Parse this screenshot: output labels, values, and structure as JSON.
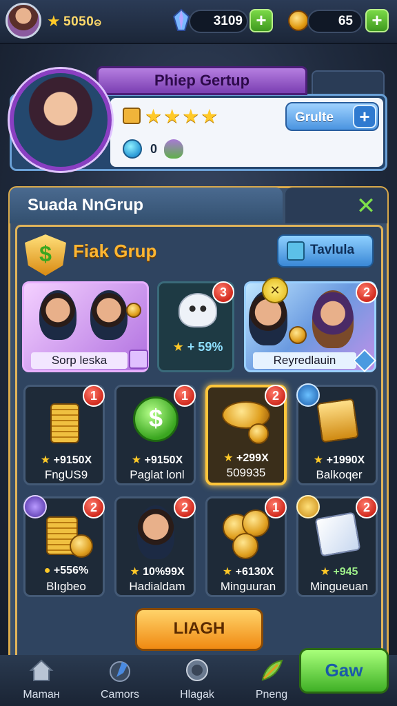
{
  "topbar": {
    "score": "5050ဓ",
    "gems": "3109",
    "coins": "65"
  },
  "profile": {
    "name": "Phiep Gertup",
    "stars": "★★★★",
    "zero_count": "0",
    "action_label": "Grulte"
  },
  "panel": {
    "title": "Suada NnGrup",
    "section_title": "Fiak Grup",
    "tab_button_label": "Tavlula"
  },
  "featured": [
    {
      "label": "Sorp leska",
      "badge": ""
    },
    {
      "label": "+ 59%",
      "badge": "3"
    },
    {
      "label": "Reyredlauin",
      "badge": "2"
    }
  ],
  "items": [
    {
      "price": "+9150X",
      "name": "FngUS9",
      "badge": "1"
    },
    {
      "price": "+9150X",
      "name": "Paglat lonl",
      "badge": "1"
    },
    {
      "price": "+299X",
      "name": "509935",
      "badge": "2"
    },
    {
      "price": "+1990X",
      "name": "Balkoqer",
      "badge": ""
    },
    {
      "price": "+556%",
      "name": "Blıgbeo",
      "badge": "2"
    },
    {
      "price": "10%99X",
      "name": "Hadialdam",
      "badge": "2"
    },
    {
      "price": "+6130X",
      "name": "Minguuran",
      "badge": "1"
    },
    {
      "price": "+945",
      "name": "Mingueuan",
      "badge": "2"
    }
  ],
  "main_button_label": "LIAGH",
  "nav": {
    "items": [
      {
        "label": "Mamaн",
        "icon": "home-icon"
      },
      {
        "label": "Camors",
        "icon": "flag-icon"
      },
      {
        "label": "Hlagak",
        "icon": "badge-icon"
      },
      {
        "label": "Pneng",
        "icon": "leaf-icon"
      }
    ],
    "action_label": "Gaw"
  }
}
